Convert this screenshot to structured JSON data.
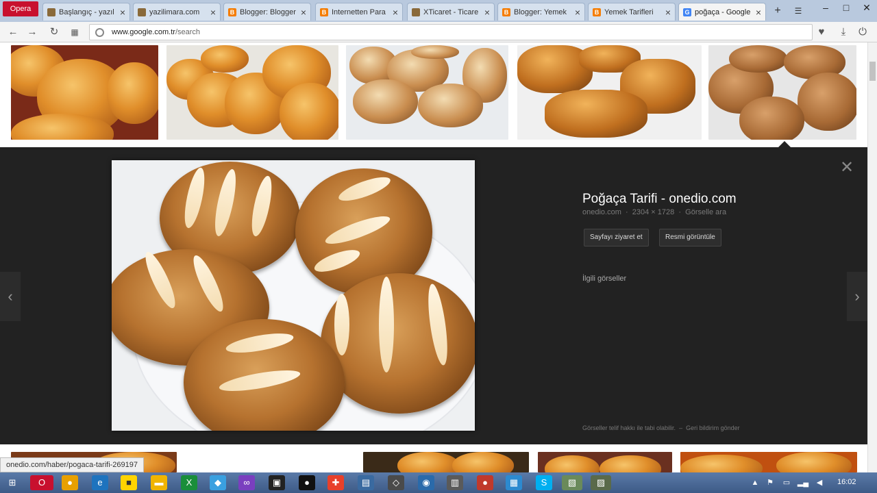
{
  "browser": {
    "menu_label": "Opera",
    "tabs": [
      {
        "title": "Başlangıç - yazıl",
        "color": "#8a6a3a"
      },
      {
        "title": "yazilimara.com",
        "color": "#8a6a3a"
      },
      {
        "title": "Blogger: Blogger",
        "color": "#f57d00"
      },
      {
        "title": "Internetten Para",
        "color": "#f57d00"
      },
      {
        "title": "XTicaret - Ticare",
        "color": "#8a6a3a"
      },
      {
        "title": "Blogger: Yemek",
        "color": "#f57d00"
      },
      {
        "title": "Yemek Tarifleri",
        "color": "#f57d00"
      },
      {
        "title": "poğaça - Google",
        "color": "#4285f4",
        "active": true
      }
    ],
    "tab_close_glyph": "×",
    "new_tab_glyph": "+",
    "url_host": "www.google.com.tr",
    "url_path": "/search"
  },
  "preview": {
    "title": "Poğaça Tarifi - onedio.com",
    "source": "onedio.com",
    "dimensions": "2304 × 1728",
    "action_link": "Görselle ara",
    "visit_button": "Sayfayı ziyaret et",
    "view_button": "Resmi görüntüle",
    "related_label": "İlgili görseller",
    "footer_copyright": "Görseller telif hakkı ile tabi olabilir.",
    "footer_feedback": "Geri bildirim gönder",
    "close_glyph": "✕",
    "prev_glyph": "‹",
    "next_glyph": "›"
  },
  "status_bar": {
    "hover_url": "onedio.com/haber/pogaca-tarifi-269197"
  },
  "taskbar": {
    "clock": "16:02"
  },
  "icons": [
    "back-icon",
    "forward-icon",
    "reload-icon",
    "speed-dial-icon",
    "secure-icon",
    "heart-icon",
    "download-icon",
    "power-icon"
  ]
}
